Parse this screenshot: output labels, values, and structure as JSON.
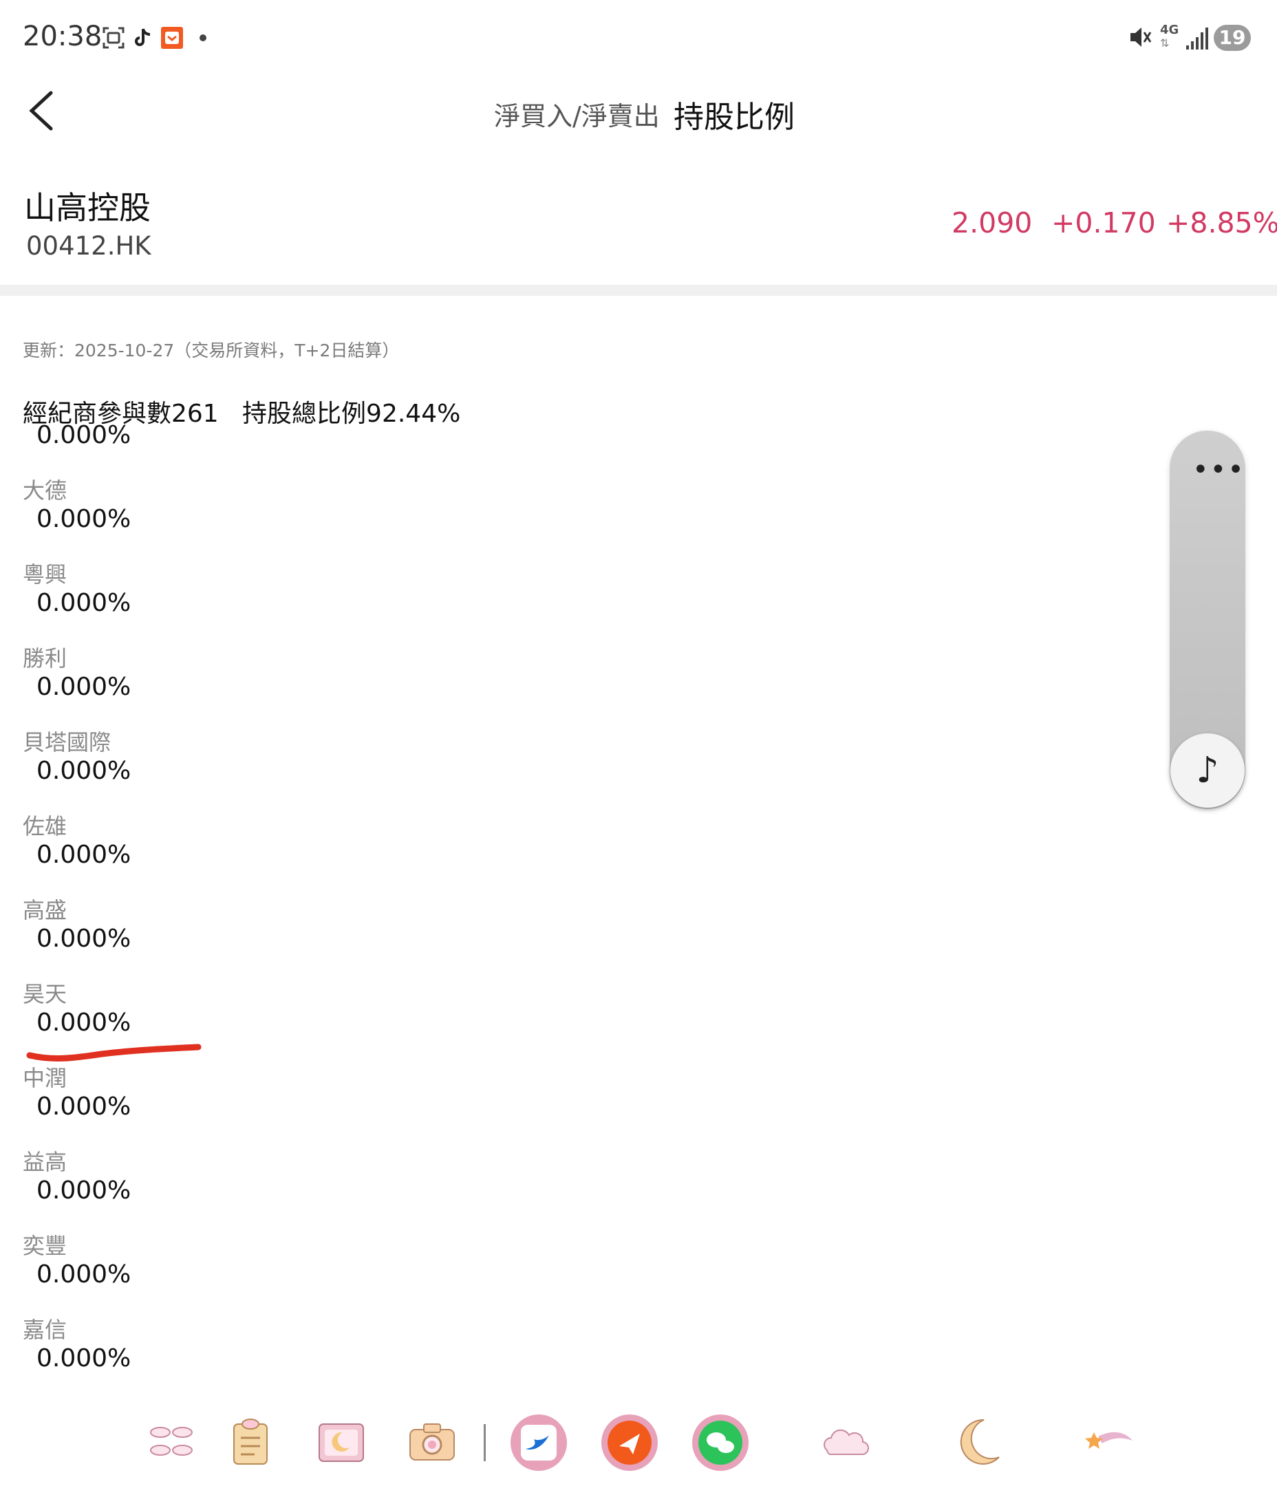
{
  "status_bar": {
    "time": "20:38",
    "left_icons": [
      "screenshot-icon",
      "tiktok-icon",
      "app-notification-icon",
      "dot-icon"
    ],
    "right_icons": [
      "mute-icon",
      "4g-icon",
      "signal-icon"
    ],
    "network": "4G",
    "battery": "19"
  },
  "header": {
    "tabs": [
      {
        "label": "淨買入/淨賣出",
        "active": false
      },
      {
        "label": "持股比例",
        "active": true
      }
    ]
  },
  "stock": {
    "name": "山高控股",
    "code": "00412.HK",
    "price": "2.090",
    "change": "+0.170",
    "change_pct": "+8.85%",
    "up_color": "#d13a63"
  },
  "info": {
    "update_text": "更新：2025-10-27（交易所資料，T+2日結算）",
    "summary_text": "經紀商參與數261   持股總比例92.44%"
  },
  "holders": {
    "first_value": "0.000%",
    "rows": [
      {
        "name": "大德",
        "value": "0.000%"
      },
      {
        "name": "粵興",
        "value": "0.000%"
      },
      {
        "name": "勝利",
        "value": "0.000%"
      },
      {
        "name": "貝塔國際",
        "value": "0.000%"
      },
      {
        "name": "佐雄",
        "value": "0.000%"
      },
      {
        "name": "高盛",
        "value": "0.000%"
      },
      {
        "name": "昊天",
        "value": "0.000%"
      },
      {
        "name": "中潤",
        "value": "0.000%"
      },
      {
        "name": "益高",
        "value": "0.000%"
      },
      {
        "name": "奕豐",
        "value": "0.000%"
      },
      {
        "name": "嘉信",
        "value": "0.000%"
      }
    ]
  },
  "floating_panel": {
    "more_label": "•••",
    "music_label": "♪"
  },
  "dock": {
    "icons": [
      "cloud-sticker-icon",
      "clipboard-icon",
      "moon-frame-icon",
      "camera-icon",
      "bird-app-icon",
      "paper-plane-app-icon",
      "wechat-icon",
      "cloud-icon",
      "moon-icon",
      "shooting-star-icon"
    ]
  },
  "annotation": {
    "underline_color": "#e03020"
  }
}
